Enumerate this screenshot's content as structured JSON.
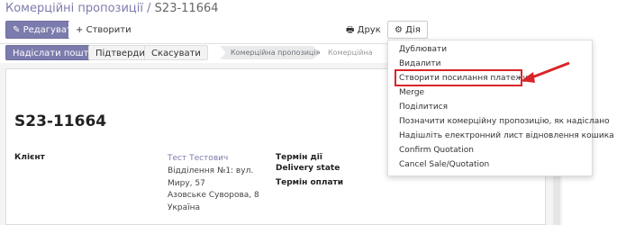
{
  "breadcrumb": {
    "parent": "Комерційні пропозиції",
    "separator": "/",
    "current": "S23-11664"
  },
  "toolbar": {
    "edit_label": "Редагувати",
    "create_label": "Створити",
    "print_label": "Друк",
    "action_label": "Дія"
  },
  "statusbar": {
    "buttons": [
      "Надіслати поштою",
      "Підтвердити",
      "Скасувати"
    ],
    "stages": [
      "Комерційна пропозиція",
      "Комерційна пропо..."
    ]
  },
  "record": {
    "name": "S23-11664",
    "client_label": "Клієнт",
    "client_name": "Тест Тестович",
    "client_address": [
      "Відділення №1: вул.",
      "Миру, 57",
      "Азовське Суворова, 8",
      "Україна"
    ],
    "fields": [
      "Термін дії",
      "Delivery state",
      "Термін оплати"
    ]
  },
  "action_menu": {
    "items": [
      "Дублювати",
      "Видалити",
      "Створити посилання платежу",
      "Merge",
      "Поділитися",
      "Позначити комерційну пропозицію, як надісланo",
      "Надішліть електронний лист відновлення кошика",
      "Confirm Quotation",
      "Cancel Sale/Quotation"
    ],
    "highlighted_index": 2
  },
  "colors": {
    "accent": "#7c7bad",
    "highlight": "#d9252a"
  }
}
